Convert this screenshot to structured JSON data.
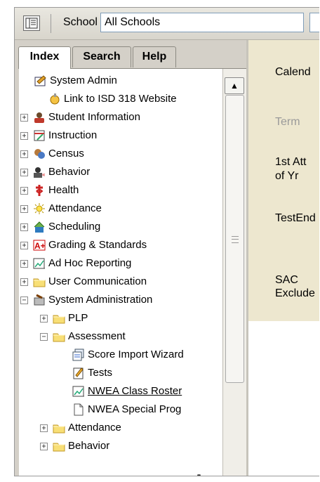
{
  "toolbar": {
    "school_label": "School",
    "school_value": "All Schools"
  },
  "tabs": [
    "Index",
    "Search",
    "Help"
  ],
  "tree": [
    {
      "label": "System Admin",
      "icon": "system-admin-icon",
      "exp": ""
    },
    {
      "label": "Link to ISD 318 Website",
      "icon": "link-icon",
      "exp": ""
    },
    {
      "label": "Student Information",
      "icon": "student-information-icon",
      "exp": "+"
    },
    {
      "label": "Instruction",
      "icon": "instruction-icon",
      "exp": "+"
    },
    {
      "label": "Census",
      "icon": "census-icon",
      "exp": "+"
    },
    {
      "label": "Behavior",
      "icon": "behavior-icon",
      "exp": "+"
    },
    {
      "label": "Health",
      "icon": "health-icon",
      "exp": "+"
    },
    {
      "label": "Attendance",
      "icon": "attendance-icon",
      "exp": "+"
    },
    {
      "label": "Scheduling",
      "icon": "scheduling-icon",
      "exp": "+"
    },
    {
      "label": "Grading & Standards",
      "icon": "grading-icon",
      "exp": "+"
    },
    {
      "label": "Ad Hoc Reporting",
      "icon": "report-icon",
      "exp": "+"
    },
    {
      "label": "User Communication",
      "icon": "folder-icon",
      "exp": "+"
    },
    {
      "label": "System Administration",
      "icon": "tools-icon",
      "exp": "−"
    },
    {
      "label": "PLP",
      "icon": "folder-icon",
      "exp": "+"
    },
    {
      "label": "Assessment",
      "icon": "folder-icon",
      "exp": "−"
    },
    {
      "label": "Score Import Wizard",
      "icon": "wizard-icon",
      "exp": ""
    },
    {
      "label": "Tests",
      "icon": "tests-icon",
      "exp": ""
    },
    {
      "label": "NWEA Class Roster",
      "icon": "report-icon",
      "exp": ""
    },
    {
      "label": "NWEA Special Prog",
      "icon": "document-icon",
      "exp": ""
    },
    {
      "label": "Attendance",
      "icon": "folder-icon",
      "exp": "+"
    },
    {
      "label": "Behavior",
      "icon": "folder-icon",
      "exp": "+"
    }
  ],
  "right_panel": {
    "calendar": "Calend",
    "term": "Term",
    "first_att_1": "1st Att",
    "first_att_2": "of Yr",
    "test_end": "TestEnd",
    "sac_1": "SAC",
    "sac_2": "Exclude"
  },
  "colors": {
    "tab_bg": "#d4d0c8",
    "right_panel_bg": "#ede7cf",
    "link": "#000000"
  }
}
